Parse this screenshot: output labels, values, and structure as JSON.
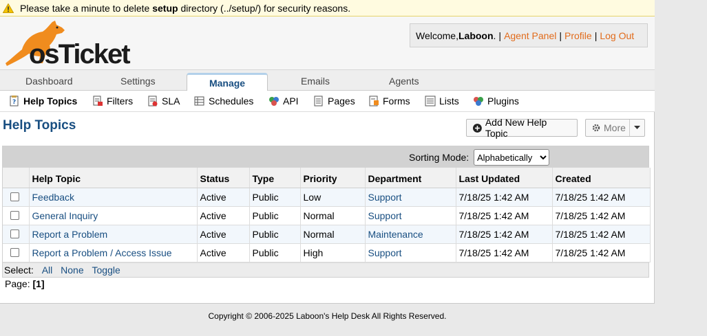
{
  "warning": {
    "prefix": "Please take a minute to delete ",
    "bold": "setup",
    "suffix": " directory (../setup/) for security reasons."
  },
  "logo": {
    "text": "osTicket"
  },
  "user_box": {
    "welcome": "Welcome, ",
    "name": "Laboon",
    "after_name": ".",
    "links": [
      "Agent Panel",
      "Profile",
      "Log Out"
    ]
  },
  "tabs": [
    "Dashboard",
    "Settings",
    "Manage",
    "Emails",
    "Agents"
  ],
  "active_tab": "Manage",
  "subnav": [
    {
      "label": "Help Topics",
      "icon": "help-topics-icon"
    },
    {
      "label": "Filters",
      "icon": "filters-icon"
    },
    {
      "label": "SLA",
      "icon": "sla-icon"
    },
    {
      "label": "Schedules",
      "icon": "schedules-icon"
    },
    {
      "label": "API",
      "icon": "api-icon"
    },
    {
      "label": "Pages",
      "icon": "pages-icon"
    },
    {
      "label": "Forms",
      "icon": "forms-icon"
    },
    {
      "label": "Lists",
      "icon": "lists-icon"
    },
    {
      "label": "Plugins",
      "icon": "plugins-icon"
    }
  ],
  "page_title": "Help Topics",
  "buttons": {
    "add_new": "Add New Help Topic",
    "more": "More"
  },
  "sorting": {
    "label": "Sorting Mode:",
    "selected": "Alphabetically"
  },
  "table": {
    "columns": [
      "Help Topic",
      "Status",
      "Type",
      "Priority",
      "Department",
      "Last Updated",
      "Created"
    ],
    "rows": [
      {
        "topic": "Feedback",
        "status": "Active",
        "type": "Public",
        "priority": "Low",
        "department": "Support",
        "updated": "7/18/25 1:42 AM",
        "created": "7/18/25 1:42 AM"
      },
      {
        "topic": "General Inquiry",
        "status": "Active",
        "type": "Public",
        "priority": "Normal",
        "department": "Support",
        "updated": "7/18/25 1:42 AM",
        "created": "7/18/25 1:42 AM"
      },
      {
        "topic": "Report a Problem",
        "status": "Active",
        "type": "Public",
        "priority": "Normal",
        "department": "Maintenance",
        "updated": "7/18/25 1:42 AM",
        "created": "7/18/25 1:42 AM"
      },
      {
        "topic": "Report a Problem / Access Issue",
        "status": "Active",
        "type": "Public",
        "priority": "High",
        "department": "Support",
        "updated": "7/18/25 1:42 AM",
        "created": "7/18/25 1:42 AM"
      }
    ]
  },
  "select_bar": {
    "label": "Select:",
    "all": "All",
    "none": "None",
    "toggle": "Toggle"
  },
  "pager": {
    "label": "Page:",
    "current": "[1]"
  },
  "footer": "Copyright © 2006-2025 Laboon's Help Desk All Rights Reserved.",
  "colors": {
    "link": "#184e81",
    "orange": "#e16b1b",
    "warning_bg": "#fffbe0"
  }
}
